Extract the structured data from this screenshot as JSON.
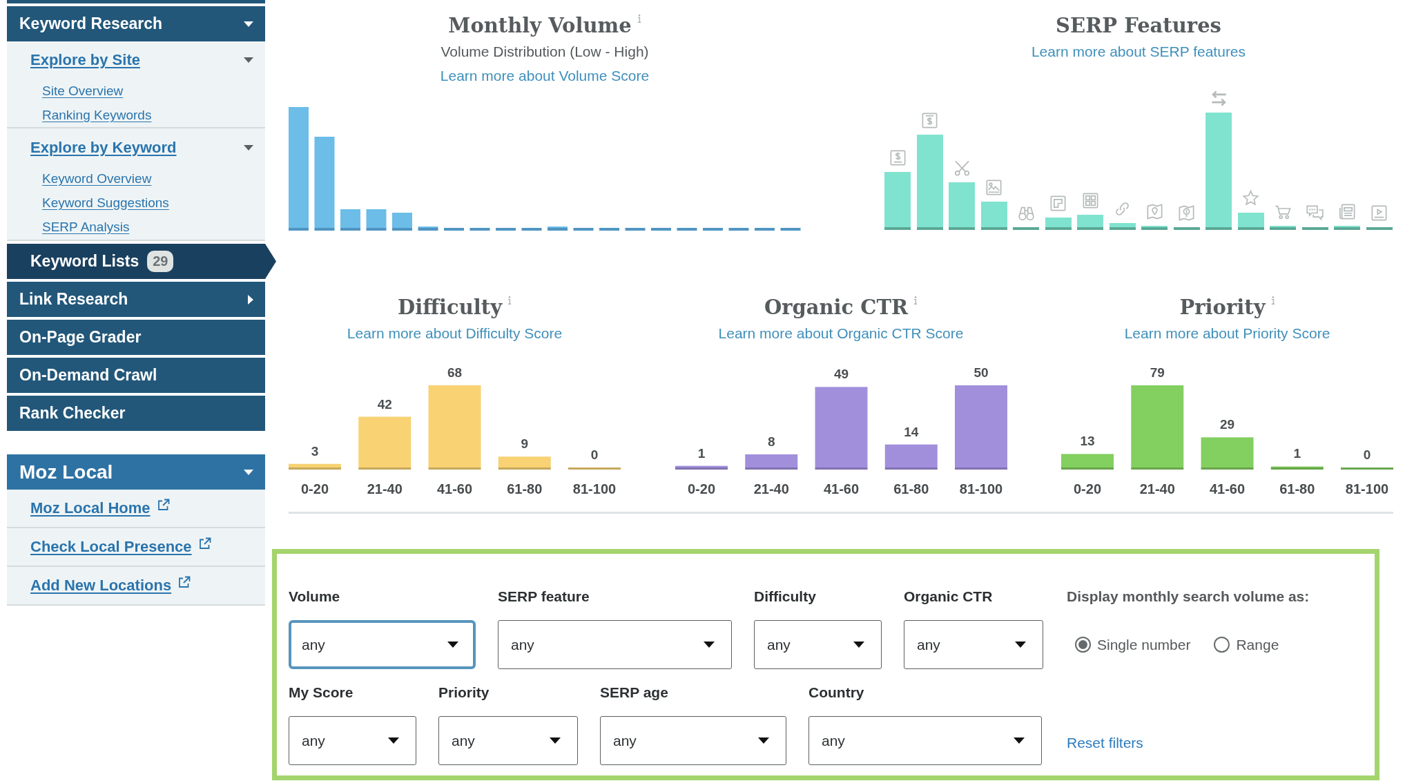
{
  "sidebar": {
    "nav": [
      {
        "kind": "group",
        "label": "Keyword Research",
        "selected": false,
        "expanded": true,
        "children": [
          {
            "label": "Explore by Site",
            "expanded": true,
            "children": [
              {
                "label": "Site Overview"
              },
              {
                "label": "Ranking Keywords"
              }
            ]
          },
          {
            "label": "Explore by Keyword",
            "expanded": true,
            "children": [
              {
                "label": "Keyword Overview"
              },
              {
                "label": "Keyword Suggestions"
              },
              {
                "label": "SERP Analysis"
              }
            ]
          }
        ]
      },
      {
        "kind": "link",
        "label": "Keyword Lists",
        "selected": true,
        "badge": "29"
      },
      {
        "kind": "group",
        "label": "Link Research",
        "selected": false,
        "expanded": false
      },
      {
        "kind": "link",
        "label": "On-Page Grader",
        "selected": false
      },
      {
        "kind": "link",
        "label": "On-Demand Crawl",
        "selected": false
      },
      {
        "kind": "link",
        "label": "Rank Checker",
        "selected": false
      }
    ],
    "local": {
      "label": "Moz Local",
      "expanded": true,
      "items": [
        {
          "label": "Moz Local Home",
          "external": true
        },
        {
          "label": "Check Local Presence",
          "external": true
        },
        {
          "label": "Add New Locations",
          "external": true
        }
      ]
    }
  },
  "volume": {
    "title": "Monthly Volume",
    "info_icon": true,
    "subtitle": "Volume Distribution (Low - High)",
    "link": "Learn more about Volume Score"
  },
  "serp_features": {
    "title": "SERP Features",
    "link": "Learn more about SERP features"
  },
  "score_charts": [
    {
      "info_icon": true,
      "link": "Learn more about Difficulty Score",
      "color": "#f8d273",
      "chart_data": {
        "type": "bar",
        "title": "Difficulty",
        "categories": [
          "0-20",
          "21-40",
          "41-60",
          "61-80",
          "81-100"
        ],
        "values": [
          3,
          42,
          68,
          9,
          0
        ],
        "data_labels": true
      }
    },
    {
      "info_icon": true,
      "link": "Learn more about Organic CTR Score",
      "color": "#a18fdc",
      "chart_data": {
        "type": "bar",
        "title": "Organic CTR",
        "categories": [
          "0-20",
          "21-40",
          "41-60",
          "61-80",
          "81-100"
        ],
        "values": [
          1,
          8,
          49,
          14,
          50
        ],
        "data_labels": true
      }
    },
    {
      "info_icon": true,
      "link": "Learn more about Priority Score",
      "color": "#83cf60",
      "chart_data": {
        "type": "bar",
        "title": "Priority",
        "categories": [
          "0-20",
          "21-40",
          "41-60",
          "61-80",
          "81-100"
        ],
        "values": [
          13,
          79,
          29,
          1,
          0
        ],
        "data_labels": true
      }
    }
  ],
  "filters": {
    "rows": [
      {
        "fields": [
          {
            "label": "Volume",
            "value": "any",
            "focused": true
          },
          {
            "label": "SERP feature",
            "value": "any",
            "focused": false
          },
          {
            "label": "Difficulty",
            "value": "any",
            "focused": false
          },
          {
            "label": "Organic CTR",
            "value": "any",
            "focused": false
          }
        ]
      },
      {
        "fields": [
          {
            "label": "My Score",
            "value": "any",
            "focused": false
          },
          {
            "label": "Priority",
            "value": "any",
            "focused": false
          },
          {
            "label": "SERP age",
            "value": "any",
            "focused": false
          },
          {
            "label": "Country",
            "value": "any",
            "focused": false
          }
        ]
      }
    ],
    "display_as": {
      "label": "Display monthly search volume as:",
      "options": [
        {
          "label": "Single number",
          "selected": true
        },
        {
          "label": "Range",
          "selected": false
        }
      ]
    },
    "reset_link": "Reset filters"
  }
}
